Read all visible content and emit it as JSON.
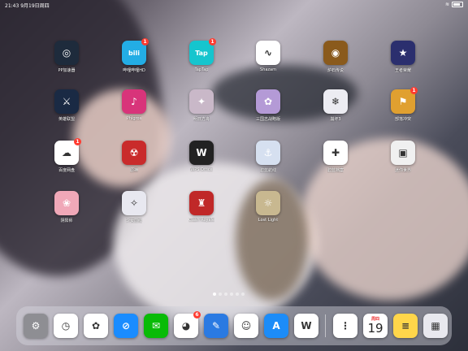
{
  "status": {
    "time": "21:43",
    "date": "9月19日周四",
    "battery": ""
  },
  "apps": [
    {
      "label": "PP加速器",
      "color": "#1e2b3c",
      "glyph": "◎",
      "badge": ""
    },
    {
      "label": "哔哩哔哩HD",
      "color": "#23ade5",
      "glyph": "bili",
      "badge": "1"
    },
    {
      "label": "TapTap",
      "color": "#15c5ce",
      "glyph": "Tap",
      "badge": "1"
    },
    {
      "label": "Shazam",
      "color": "#ffffff",
      "glyph": "∿",
      "badge": ""
    },
    {
      "label": "炉石传说",
      "color": "#8a5a1c",
      "glyph": "◉",
      "badge": ""
    },
    {
      "label": "王者荣耀",
      "color": "#2b2f6e",
      "glyph": "★",
      "badge": ""
    },
    {
      "label": "英雄联盟",
      "color": "#1a2a44",
      "glyph": "⚔",
      "badge": ""
    },
    {
      "label": "Phigros",
      "color": "#d8347a",
      "glyph": "♪",
      "badge": ""
    },
    {
      "label": "明日方舟",
      "color": "#c9b8c8",
      "glyph": "✦",
      "badge": ""
    },
    {
      "label": "三国志战略版",
      "color": "#b49ad6",
      "glyph": "✿",
      "badge": ""
    },
    {
      "label": "崩坏3",
      "color": "#ececf2",
      "glyph": "❄",
      "badge": ""
    },
    {
      "label": "部落冲突",
      "color": "#e0a030",
      "glyph": "⚑",
      "badge": "1"
    },
    {
      "label": "百度网盘",
      "color": "#ffffff",
      "glyph": "☁",
      "badge": "1"
    },
    {
      "label": "原神",
      "color": "#c92b2b",
      "glyph": "☢",
      "badge": ""
    },
    {
      "label": "WPS Office",
      "color": "#222222",
      "glyph": "W",
      "badge": ""
    },
    {
      "label": "碧蓝航线",
      "color": "#d6e0f0",
      "glyph": "⚓",
      "badge": ""
    },
    {
      "label": "碧蓝档案",
      "color": "#ffffff",
      "glyph": "✚",
      "badge": ""
    },
    {
      "label": "迷你世界",
      "color": "#f0f0f0",
      "glyph": "▣",
      "badge": ""
    },
    {
      "label": "阴阳师",
      "color": "#f0a8b8",
      "glyph": "❀",
      "badge": ""
    },
    {
      "label": "少女前线",
      "color": "#e8e8f0",
      "glyph": "✧",
      "badge": ""
    },
    {
      "label": "Clash Royale",
      "color": "#c02828",
      "glyph": "♜",
      "badge": ""
    },
    {
      "label": "Lost Light",
      "color": "#c8b890",
      "glyph": "☼",
      "badge": ""
    }
  ],
  "dock": [
    {
      "name": "settings",
      "color": "#8e8e93",
      "glyph": "⚙"
    },
    {
      "name": "clock",
      "color": "#ffffff",
      "glyph": "◷"
    },
    {
      "name": "photos",
      "color": "#ffffff",
      "glyph": "✿"
    },
    {
      "name": "safari",
      "color": "#1a8cff",
      "glyph": "⊘"
    },
    {
      "name": "wechat",
      "color": "#09bb07",
      "glyph": "✉"
    },
    {
      "name": "weibo",
      "color": "#ffffff",
      "glyph": "◕",
      "badge": "6"
    },
    {
      "name": "notes-pen",
      "color": "#2a7ae2",
      "glyph": "✎"
    },
    {
      "name": "qq",
      "color": "#ffffff",
      "glyph": "☺"
    },
    {
      "name": "app-store",
      "color": "#1c8cf8",
      "glyph": "A"
    },
    {
      "name": "wps",
      "color": "#ffffff",
      "glyph": "W"
    },
    {
      "name": "reminders",
      "color": "#ffffff",
      "glyph": "⋮"
    },
    {
      "name": "calendar",
      "color": "#ffffff",
      "glyph": "",
      "day": "周四",
      "date": "19"
    },
    {
      "name": "notes",
      "color": "#ffd64a",
      "glyph": "≡"
    },
    {
      "name": "app-library",
      "color": "#e8e8ee",
      "glyph": "▦"
    }
  ],
  "page_dots": 6
}
